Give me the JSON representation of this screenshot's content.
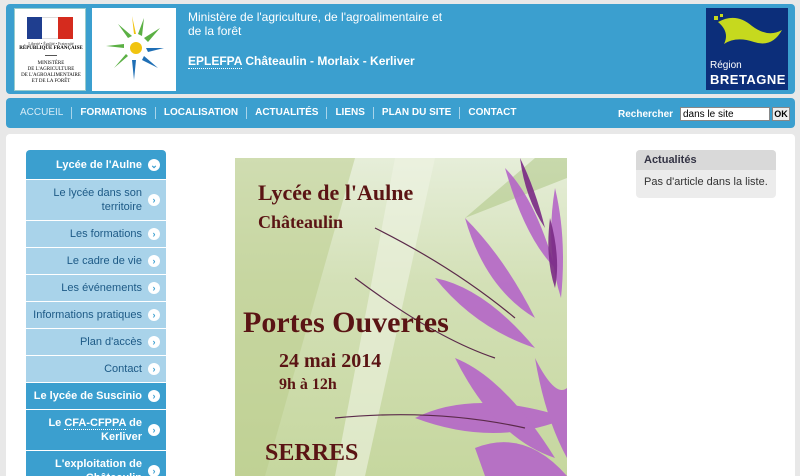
{
  "header": {
    "rf_logo": {
      "motto": "Liberté • Égalité • Fraternité",
      "republic": "RÉPUBLIQUE FRANÇAISE",
      "ministry_lines": [
        "MINISTÈRE",
        "DE L'AGRICULTURE",
        "DE L'AGROALIMENTAIRE",
        "ET DE LA FORÊT"
      ]
    },
    "ministry_title": "Ministère de l'agriculture, de l'agroalimentaire et de la forêt",
    "school_abbr": "EPLEFPA",
    "school_sites": " Châteaulin - Morlaix - Kerliver",
    "region_logo": {
      "line1": "Région",
      "line2": "BRETAGNE"
    }
  },
  "nav": {
    "items": [
      "ACCUEIL",
      "FORMATIONS",
      "LOCALISATION",
      "ACTUALITÉS",
      "LIENS",
      "PLAN DU SITE",
      "CONTACT"
    ],
    "search_label": "Rechercher",
    "search_value": "dans le site",
    "search_button": "OK"
  },
  "sidebar": {
    "section_title": "Lycée de l'Aulne",
    "sub_items": [
      "Le lycée dans son territoire",
      "Les formations",
      "Le cadre de vie",
      "Les événements",
      "Informations pratiques",
      "Plan d'accès",
      "Contact"
    ],
    "main_items": [
      {
        "pre": "Le lycée de Suscinio",
        "abbr": "",
        "post": ""
      },
      {
        "pre": "Le ",
        "abbr": "CFA-CFPPA",
        "post": " de Kerliver"
      },
      {
        "pre": "L'exploitation de Châteaulin",
        "abbr": "",
        "post": ""
      }
    ]
  },
  "poster": {
    "line1": "Lycée de l'Aulne",
    "line2": "Châteaulin",
    "line3": "Portes Ouvertes",
    "line4": "24 mai 2014",
    "line5": "9h à 12h",
    "line6": "SERRES"
  },
  "news": {
    "title": "Actualités",
    "empty_text": "Pas d'article dans la liste."
  },
  "colors": {
    "brand_blue": "#3b9fcf",
    "sub_item_blue": "#a9d3ea",
    "region_navy": "#0c2e7a",
    "poster_text": "#5a1414"
  }
}
